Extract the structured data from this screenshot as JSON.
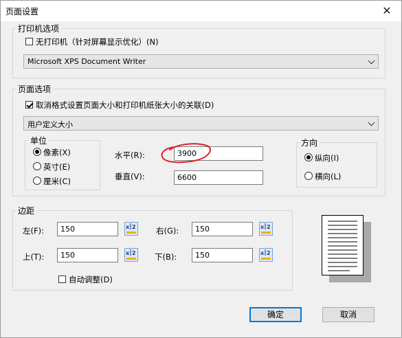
{
  "window": {
    "title": "页面设置",
    "close_glyph": "✕"
  },
  "printer": {
    "legend": "打印机选项",
    "no_printer_label": "无打印机（针对屏幕显示优化）(N)",
    "no_printer_checked": false,
    "selected": "Microsoft XPS Document Writer"
  },
  "page": {
    "legend": "页面选项",
    "unlink_label": "取消格式设置页面大小和打印机纸张大小的关联(D)",
    "unlink_checked": true,
    "size_selected": "用户定义大小",
    "unit": {
      "legend": "单位",
      "options": [
        "像素(X)",
        "英寸(E)",
        "厘米(C)"
      ],
      "selected": "像素(X)"
    },
    "width_label": "水平(R):",
    "width_value": "3900",
    "height_label": "垂直(V):",
    "height_value": "6600",
    "orientation": {
      "legend": "方向",
      "options": [
        "纵向(I)",
        "横向(L)"
      ],
      "selected": "纵向(I)"
    }
  },
  "margins": {
    "legend": "边距",
    "left_label": "左(F):",
    "left_value": "150",
    "right_label": "右(G):",
    "right_value": "150",
    "top_label": "上(T):",
    "top_value": "150",
    "bottom_label": "下(B):",
    "bottom_value": "150",
    "auto_label": "自动调整(D)",
    "auto_checked": false
  },
  "buttons": {
    "ok": "确定",
    "cancel": "取消"
  },
  "annotation": {
    "color": "#e0202a"
  }
}
